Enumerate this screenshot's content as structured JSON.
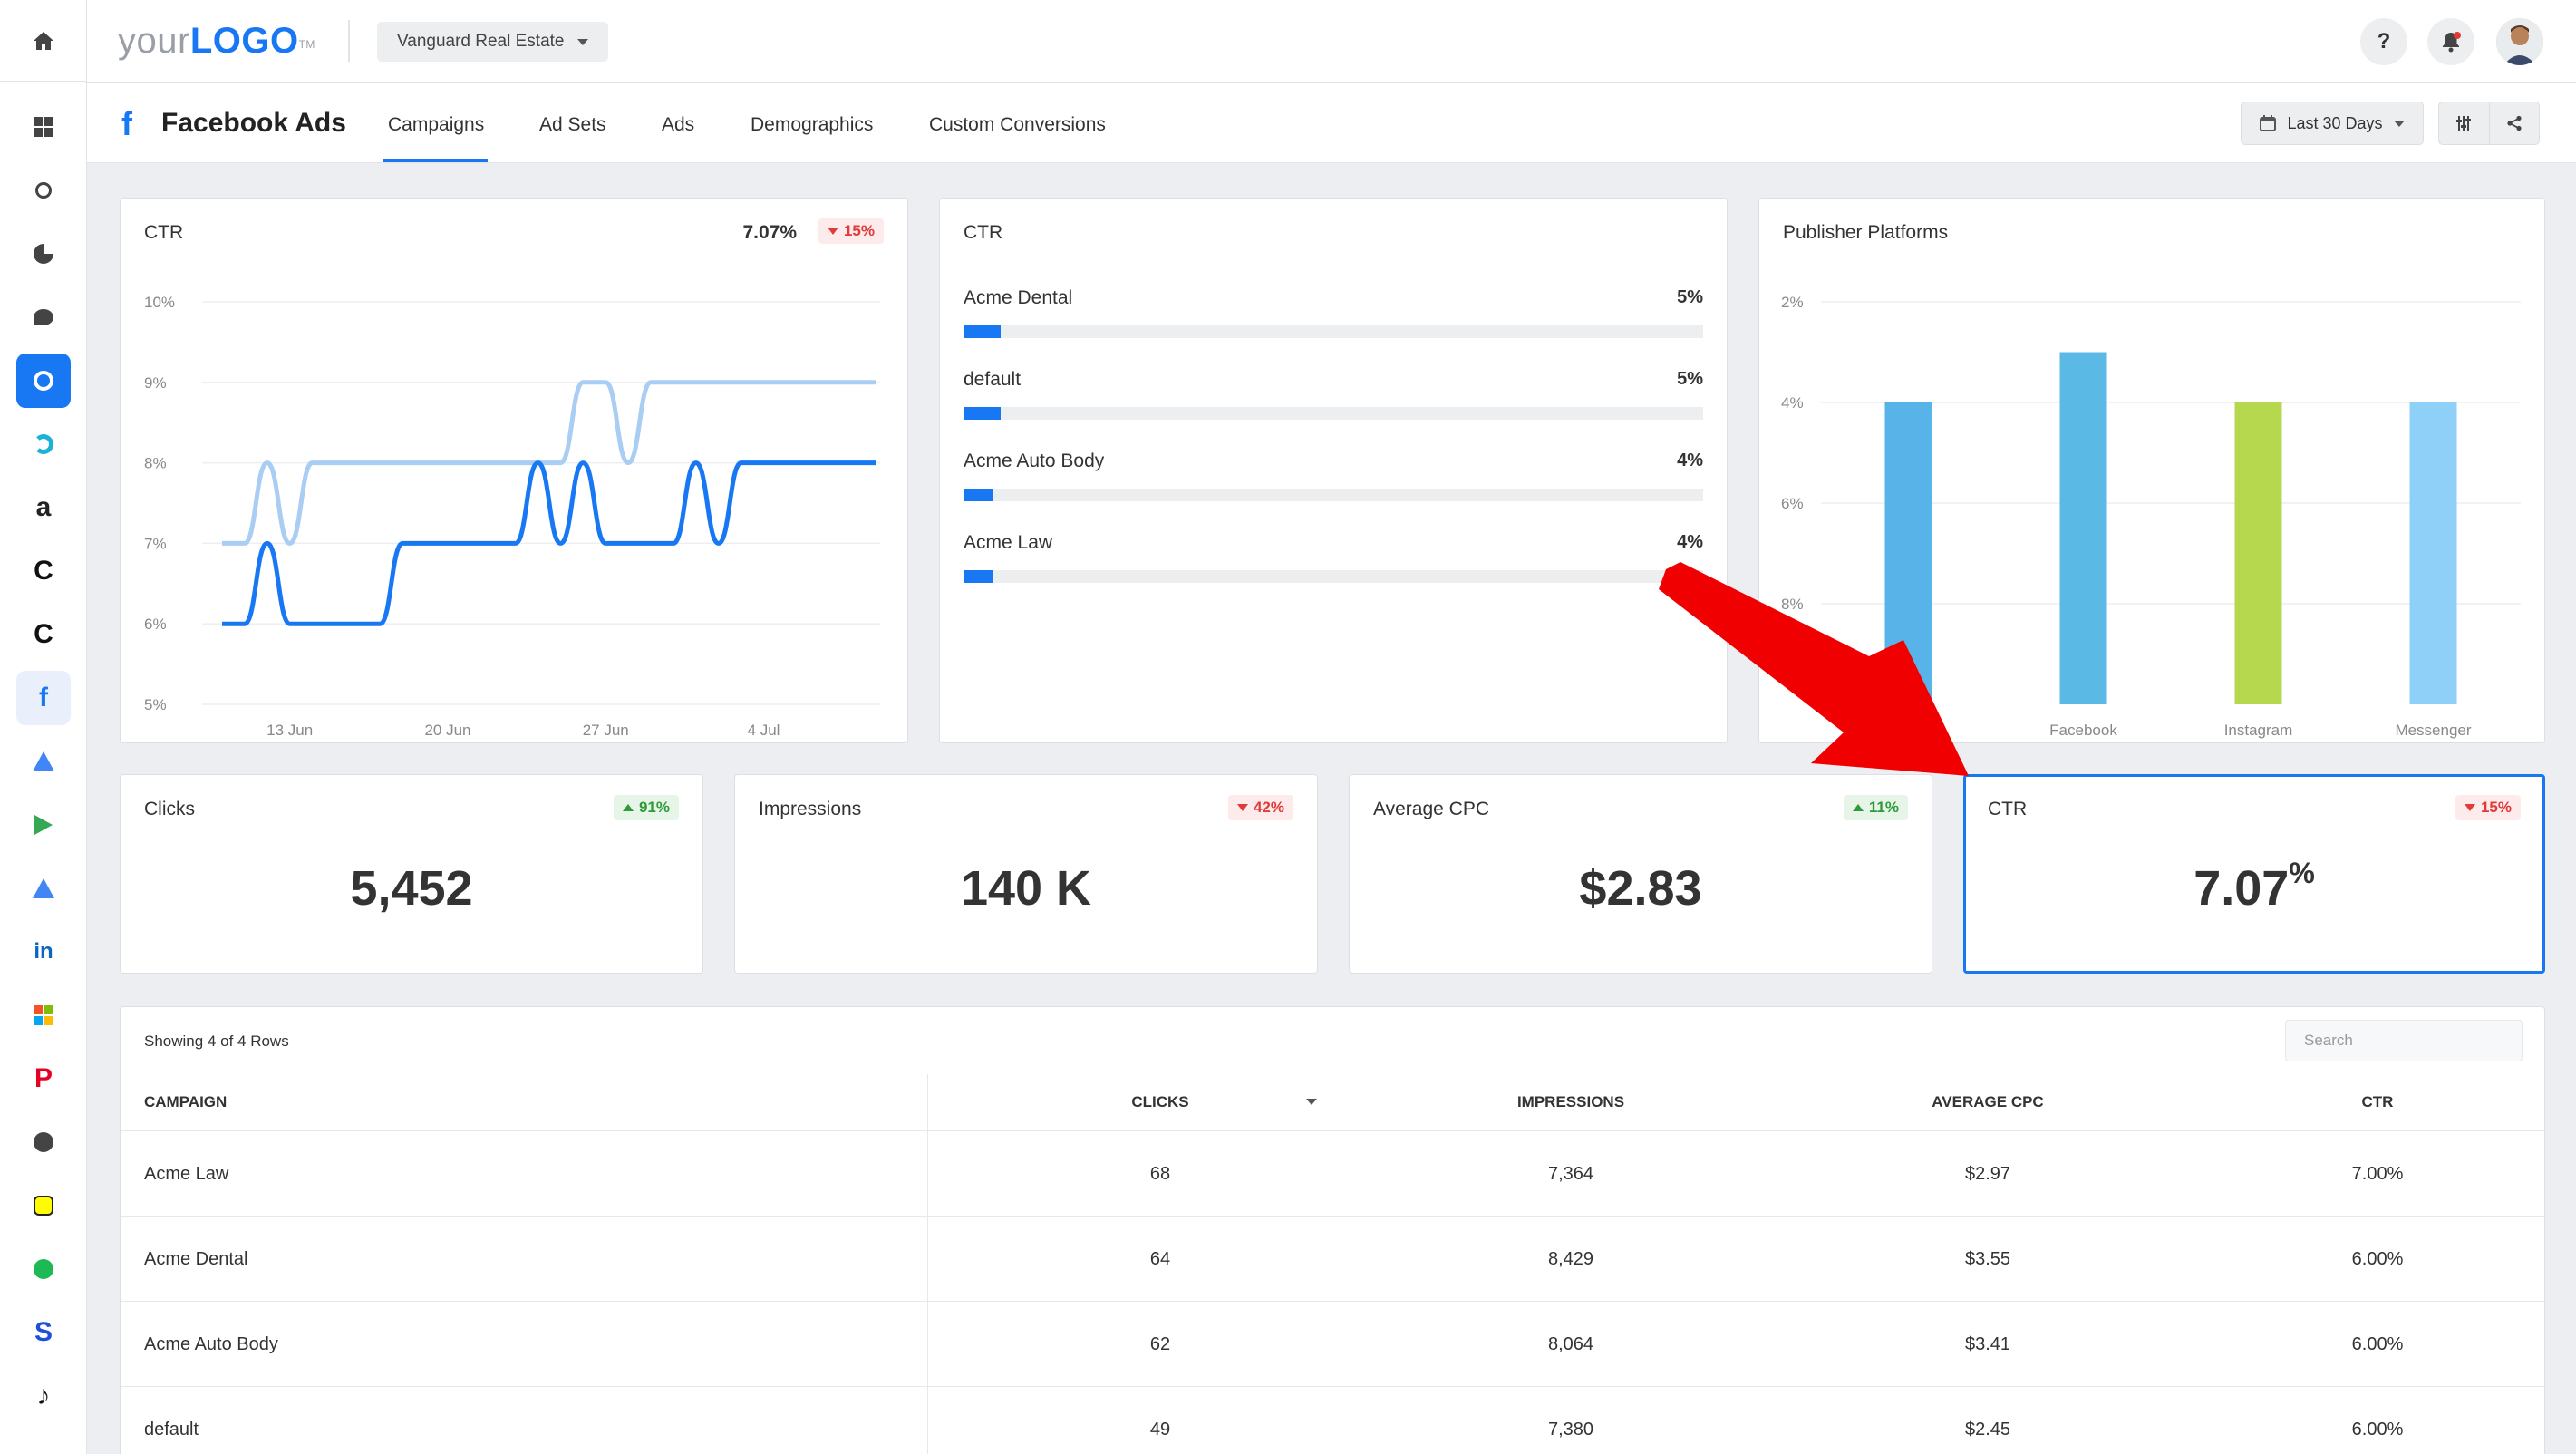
{
  "app": {
    "logo_prefix": "your",
    "logo_main": "LOGO",
    "logo_tm": "TM",
    "account": "Vanguard Real Estate",
    "help_label": "?"
  },
  "rail": {
    "items": [
      {
        "icon": "dashboard-icon"
      },
      {
        "icon": "search-icon"
      },
      {
        "icon": "pie-chart-icon"
      },
      {
        "icon": "chat-icon"
      },
      {
        "icon": "active-integration-icon"
      },
      {
        "icon": "callrail-icon"
      },
      {
        "icon": "amazon-icon",
        "glyph": "a"
      },
      {
        "icon": "c-integration-icon",
        "glyph": "C"
      },
      {
        "icon": "c-integration-icon-2",
        "glyph": "C"
      },
      {
        "icon": "facebook-icon",
        "glyph": "f"
      },
      {
        "icon": "google-ads-icon"
      },
      {
        "icon": "google-play-icon"
      },
      {
        "icon": "google-ads-icon-2"
      },
      {
        "icon": "linkedin-icon",
        "glyph": "in"
      },
      {
        "icon": "microsoft-icon"
      },
      {
        "icon": "pinterest-icon",
        "glyph": "P"
      },
      {
        "icon": "reddit-icon"
      },
      {
        "icon": "snapchat-icon"
      },
      {
        "icon": "spotify-icon"
      },
      {
        "icon": "stackadapt-icon",
        "glyph": "S"
      },
      {
        "icon": "tiktok-icon",
        "glyph": "♪"
      }
    ]
  },
  "header": {
    "title": "Facebook Ads",
    "fb_glyph": "f",
    "tabs": [
      "Campaigns",
      "Ad Sets",
      "Ads",
      "Demographics",
      "Custom Conversions"
    ],
    "active_tab": "Campaigns",
    "date_range": "Last 30 Days"
  },
  "ctr_line": {
    "title": "CTR",
    "value": "7.07%",
    "change": "15%",
    "change_dir": "down"
  },
  "ctr_bars": {
    "title": "CTR",
    "rows": [
      {
        "label": "Acme Dental",
        "value": "5%",
        "fraction": 0.05
      },
      {
        "label": "default",
        "value": "5%",
        "fraction": 0.05
      },
      {
        "label": "Acme Auto Body",
        "value": "4%",
        "fraction": 0.04
      },
      {
        "label": "Acme Law",
        "value": "4%",
        "fraction": 0.04
      }
    ]
  },
  "publisher": {
    "title": "Publisher Platforms"
  },
  "kpis": [
    {
      "title": "Clicks",
      "value": "5,452",
      "change": "91%",
      "dir": "up"
    },
    {
      "title": "Impressions",
      "value": "140 K",
      "change": "42%",
      "dir": "down"
    },
    {
      "title": "Average CPC",
      "value": "$2.83",
      "change": "11%",
      "dir": "up"
    },
    {
      "title": "CTR",
      "value": "7.07",
      "unit": "%",
      "change": "15%",
      "dir": "down"
    }
  ],
  "table": {
    "info": "Showing 4 of 4 Rows",
    "search_placeholder": "Search",
    "headers": [
      "Campaign",
      "Clicks",
      "Impressions",
      "Average CPC",
      "CTR"
    ],
    "rows": [
      [
        "Acme Law",
        "68",
        "7,364",
        "$2.97",
        "7.00%"
      ],
      [
        "Acme Dental",
        "64",
        "8,429",
        "$3.55",
        "6.00%"
      ],
      [
        "Acme Auto Body",
        "62",
        "8,064",
        "$3.41",
        "6.00%"
      ],
      [
        "default",
        "49",
        "7,380",
        "$2.45",
        "6.00%"
      ]
    ]
  },
  "colors": {
    "accent": "#1877f2",
    "light_series": "#a9cdf3",
    "bar_audience": "#58b4e8",
    "bar_facebook": "#5bbae5",
    "bar_instagram": "#b5d84f",
    "bar_messenger": "#8fd0f8",
    "arrow": "#f00000"
  },
  "chart_data": [
    {
      "type": "line",
      "title": "CTR",
      "x_ticks": [
        "13 Jun",
        "20 Jun",
        "27 Jun",
        "4 Jul"
      ],
      "y_ticks": [
        "5%",
        "6%",
        "7%",
        "8%",
        "9%",
        "10%"
      ],
      "ylim": [
        5,
        10
      ],
      "x": [
        1,
        2,
        3,
        4,
        5,
        6,
        7,
        8,
        9,
        10,
        11,
        12,
        13,
        14,
        15,
        16,
        17,
        18,
        19,
        20,
        21,
        22,
        23,
        24,
        25,
        26,
        27,
        28,
        29,
        30
      ],
      "series": [
        {
          "values": [
            6,
            6,
            7,
            6,
            6,
            6,
            6,
            6,
            7,
            7,
            7,
            7,
            7,
            7,
            8,
            7,
            8,
            7,
            7,
            7,
            7,
            8,
            7,
            8,
            8,
            8,
            8,
            8,
            8,
            8
          ]
        },
        {
          "values": [
            7,
            7,
            8,
            7,
            8,
            8,
            8,
            8,
            8,
            8,
            8,
            8,
            8,
            8,
            8,
            8,
            9,
            9,
            8,
            9,
            9,
            9,
            9,
            9,
            9,
            9,
            9,
            9,
            9,
            9
          ]
        }
      ]
    },
    {
      "type": "bar",
      "title": "Publisher Platforms",
      "categories": [
        "Audience Network",
        "Facebook",
        "Instagram",
        "Messenger"
      ],
      "visible_categories": [
        "…twork",
        "Facebook",
        "Instagram",
        "Messenger"
      ],
      "values": [
        6,
        7,
        6,
        6
      ],
      "y_ticks": [
        "2%",
        "4%",
        "6%",
        "8%"
      ],
      "ylim": [
        0,
        8
      ]
    }
  ]
}
